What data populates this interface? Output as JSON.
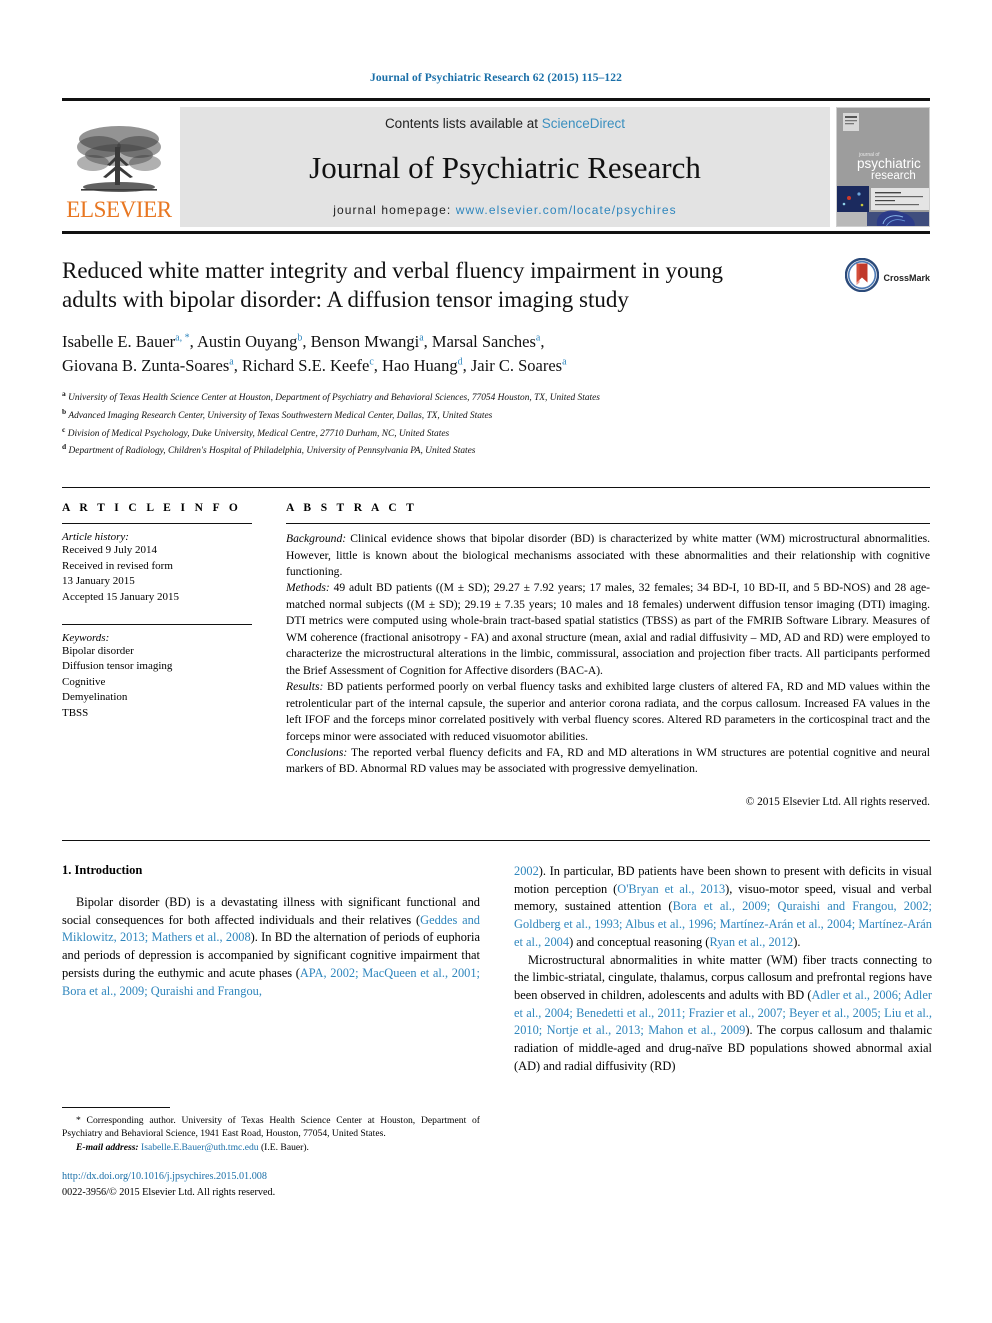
{
  "running_head": "Journal of Psychiatric Research 62 (2015) 115–122",
  "masthead": {
    "contents_prefix": "Contents lists available at ",
    "sciencedirect": "ScienceDirect",
    "journal_title": "Journal of Psychiatric Research",
    "homepage_label": "journal homepage: ",
    "homepage_url": "www.elsevier.com/locate/psychires",
    "publisher": "ELSEVIER",
    "cover_line1": "journal of",
    "cover_line2": "psychiatric",
    "cover_line3": "research",
    "accent_orange": "#e87722",
    "accent_blue": "#2f86bd"
  },
  "article": {
    "title": "Reduced white matter integrity and verbal fluency impairment in young adults with bipolar disorder: A diffusion tensor imaging study",
    "crossmark_label": "CrossMark",
    "authors_line1": [
      {
        "name": "Isabelle E. Bauer",
        "sup": "a, *"
      },
      {
        "name": "Austin Ouyang",
        "sup": "b"
      },
      {
        "name": "Benson Mwangi",
        "sup": "a"
      },
      {
        "name": "Marsal Sanches",
        "sup": "a"
      }
    ],
    "authors_line2": [
      {
        "name": "Giovana B. Zunta-Soares",
        "sup": "a"
      },
      {
        "name": "Richard S.E. Keefe",
        "sup": "c"
      },
      {
        "name": "Hao Huang",
        "sup": "d"
      },
      {
        "name": "Jair C. Soares",
        "sup": "a"
      }
    ],
    "affiliations": [
      {
        "marker": "a",
        "text": "University of Texas Health Science Center at Houston, Department of Psychiatry and Behavioral Sciences, 77054 Houston, TX, United States"
      },
      {
        "marker": "b",
        "text": "Advanced Imaging Research Center, University of Texas Southwestern Medical Center, Dallas, TX, United States"
      },
      {
        "marker": "c",
        "text": "Division of Medical Psychology, Duke University, Medical Centre, 27710 Durham, NC, United States"
      },
      {
        "marker": "d",
        "text": "Department of Radiology, Children's Hospital of Philadelphia, University of Pennsylvania PA, United States"
      }
    ]
  },
  "article_info": {
    "heading": "A R T I C L E  I N F O",
    "history_title": "Article history:",
    "history": [
      "Received 9 July 2014",
      "Received in revised form",
      "13 January 2015",
      "Accepted 15 January 2015"
    ],
    "keywords_title": "Keywords:",
    "keywords": [
      "Bipolar disorder",
      "Diffusion tensor imaging",
      "Cognitive",
      "Demyelination",
      "TBSS"
    ]
  },
  "abstract": {
    "heading": "A B S T R A C T",
    "background_label": "Background:",
    "background_text": " Clinical evidence shows that bipolar disorder (BD) is characterized by white matter (WM) microstructural abnormalities. However, little is known about the biological mechanisms associated with these abnormalities and their relationship with cognitive functioning.",
    "methods_label": "Methods:",
    "methods_text": " 49 adult BD patients ((M ± SD); 29.27 ± 7.92 years; 17 males, 32 females; 34 BD-I, 10 BD-II, and 5 BD-NOS) and 28 age-matched normal subjects ((M ± SD); 29.19 ± 7.35 years; 10 males and 18 females) underwent diffusion tensor imaging (DTI) imaging. DTI metrics were computed using whole-brain tract-based spatial statistics (TBSS) as part of the FMRIB Software Library. Measures of WM coherence (fractional anisotropy - FA) and axonal structure (mean, axial and radial diffusivity – MD, AD and RD) were employed to characterize the microstructural alterations in the limbic, commissural, association and projection fiber tracts. All participants performed the Brief Assessment of Cognition for Affective disorders (BAC-A).",
    "results_label": "Results:",
    "results_text": " BD patients performed poorly on verbal fluency tasks and exhibited large clusters of altered FA, RD and MD values within the retrolenticular part of the internal capsule, the superior and anterior corona radiata, and the corpus callosum. Increased FA values in the left IFOF and the forceps minor correlated positively with verbal fluency scores. Altered RD parameters in the corticospinal tract and the forceps minor were associated with reduced visuomotor abilities.",
    "conclusions_label": "Conclusions:",
    "conclusions_text": " The reported verbal fluency deficits and FA, RD and MD alterations in WM structures are potential cognitive and neural markers of BD. Abnormal RD values may be associated with progressive demyelination.",
    "rights": "© 2015 Elsevier Ltd. All rights reserved."
  },
  "body": {
    "section_heading": "1. Introduction",
    "left_para_1_a": "Bipolar disorder (BD) is a devastating illness with significant functional and social consequences for both affected individuals and their relatives (",
    "left_ref_1": "Geddes and Miklowitz, 2013; Mathers et al., 2008",
    "left_para_1_b": "). In BD the alternation of periods of euphoria and periods of depression is accompanied by significant cognitive impairment that persists during the euthymic and acute phases (",
    "left_ref_2": "APA, 2002; MacQueen et al., 2001; Bora et al., 2009; Quraishi and Frangou,",
    "right_ref_0": "2002",
    "right_para_0": "). In particular, BD patients have been shown to present with deficits in visual motion perception (",
    "right_ref_1": "O'Bryan et al., 2013",
    "right_para_1": "), visuo-motor speed, visual and verbal memory, sustained attention (",
    "right_ref_2": "Bora et al., 2009; Quraishi and Frangou, 2002; Goldberg et al., 1993; Albus et al., 1996; Martínez-Arán et al., 2004; Martínez-Arán et al., 2004",
    "right_para_2": ") and conceptual reasoning (",
    "right_ref_3": "Ryan et al., 2012",
    "right_para_3": ").",
    "right_para_4_a": "Microstructural abnormalities in white matter (WM) fiber tracts connecting to the limbic-striatal, cingulate, thalamus, corpus callosum and prefrontal regions have been observed in children, adolescents and adults with BD (",
    "right_ref_4": "Adler et al., 2006; Adler et al., 2004; Benedetti et al., 2011; Frazier et al., 2007; Beyer et al., 2005; Liu et al., 2010; Nortje et al., 2013; Mahon et al., 2009",
    "right_para_4_b": "). The corpus callosum and thalamic radiation of middle-aged and drug-naïve BD populations showed abnormal axial (AD) and radial diffusivity (RD)"
  },
  "footnote": {
    "corresponding": "* Corresponding author. University of Texas Health Science Center at Houston, Department of Psychiatry and Behavioral Science, 1941 East Road, Houston, 77054, United States.",
    "email_label": "E-mail address:",
    "email": "Isabelle.E.Bauer@uth.tmc.edu",
    "email_owner": " (I.E. Bauer).",
    "doi": "http://dx.doi.org/10.1016/j.jpsychires.2015.01.008",
    "issn_line": "0022-3956/© 2015 Elsevier Ltd. All rights reserved."
  }
}
